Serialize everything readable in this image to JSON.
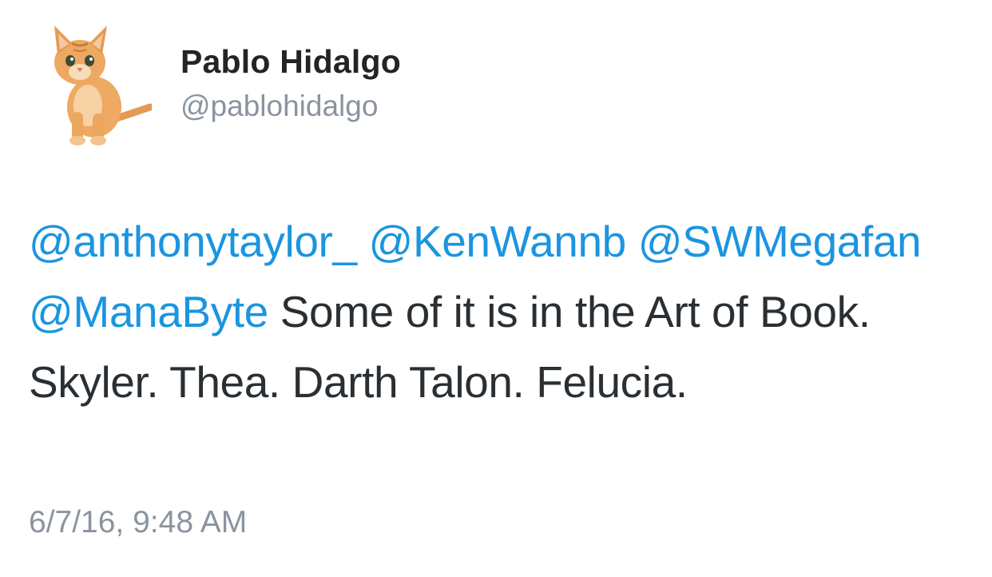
{
  "user": {
    "avatar_icon": "kitten-avatar-icon",
    "name": "Pablo Hidalgo",
    "handle": "@pablohidalgo"
  },
  "tweet": {
    "mentions": [
      "@anthonytaylor_",
      "@KenWannb",
      "@SWMegafan",
      "@ManaByte"
    ],
    "text": "Some of it is in the Art of Book. Skyler. Thea. Darth Talon. Felucia.",
    "timestamp": "6/7/16, 9:48 AM"
  },
  "colors": {
    "link": "#1b95e0",
    "text": "#292f33",
    "muted": "#8a949f"
  }
}
